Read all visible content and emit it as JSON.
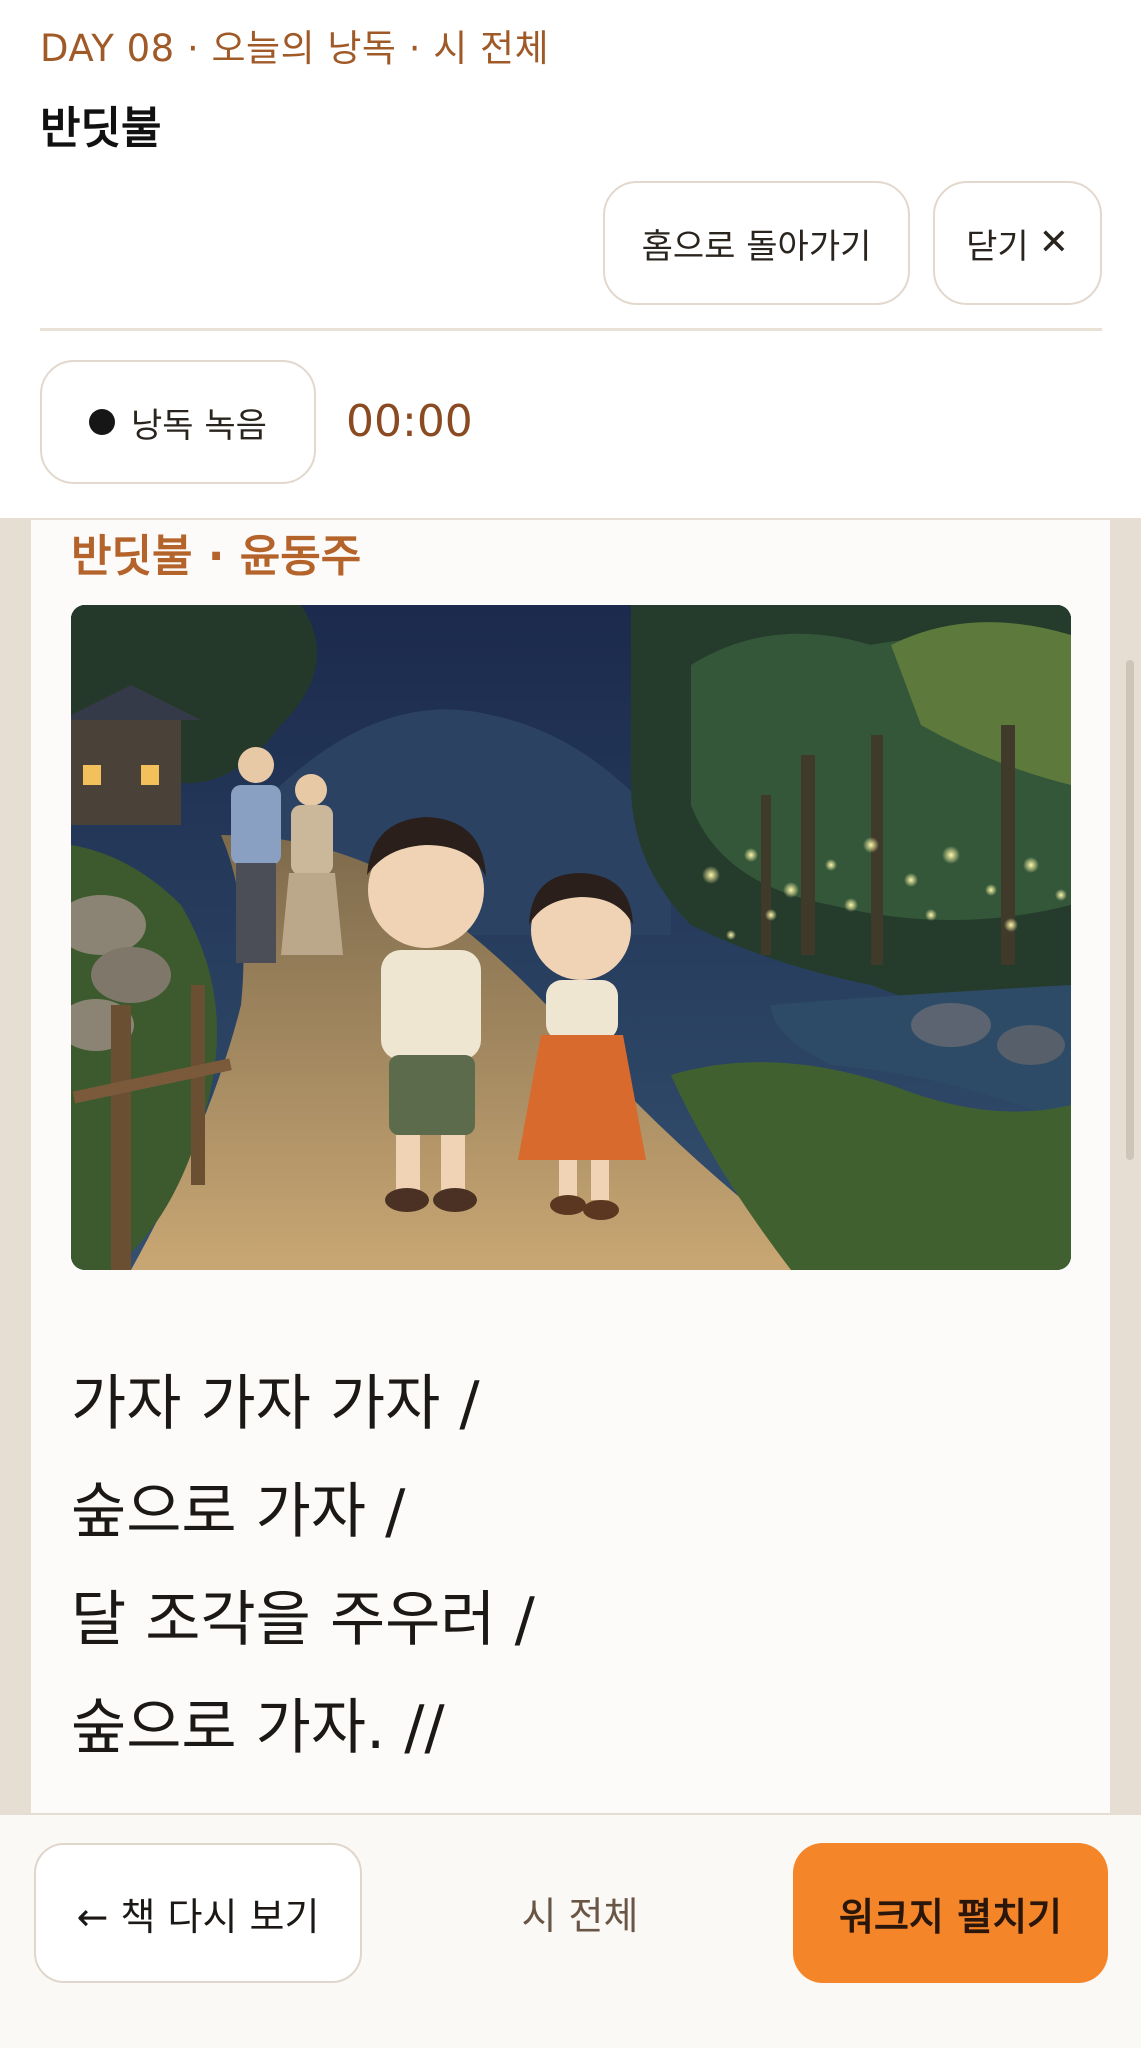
{
  "header": {
    "eyebrow": "DAY 08 · 오늘의 낭독 · 시 전체",
    "title": "반딧불",
    "home_button": "홈으로 돌아가기",
    "close_button": "닫기",
    "close_icon": "close-x-icon",
    "record_button": "낭독 녹음",
    "record_icon": "record-dot-icon",
    "timer": "00:00"
  },
  "poem": {
    "heading": "반딧불 · 윤동주",
    "image_description": "children-walking-firefly-night-path-illustration",
    "lines": [
      "가자 가자 가자 /",
      "숲으로 가자 /",
      "달 조각을 주우러 /",
      "숲으로 가자. //"
    ]
  },
  "footer": {
    "back_button": "← 책 다시 보기",
    "center_label": "시 전체",
    "worksheet_button": "워크지 펼치기"
  },
  "colors": {
    "accent_orange": "#f58529",
    "eyebrow_brown": "#a05a28",
    "content_background": "#e6ddd3",
    "card_background": "#fcfbf9"
  }
}
